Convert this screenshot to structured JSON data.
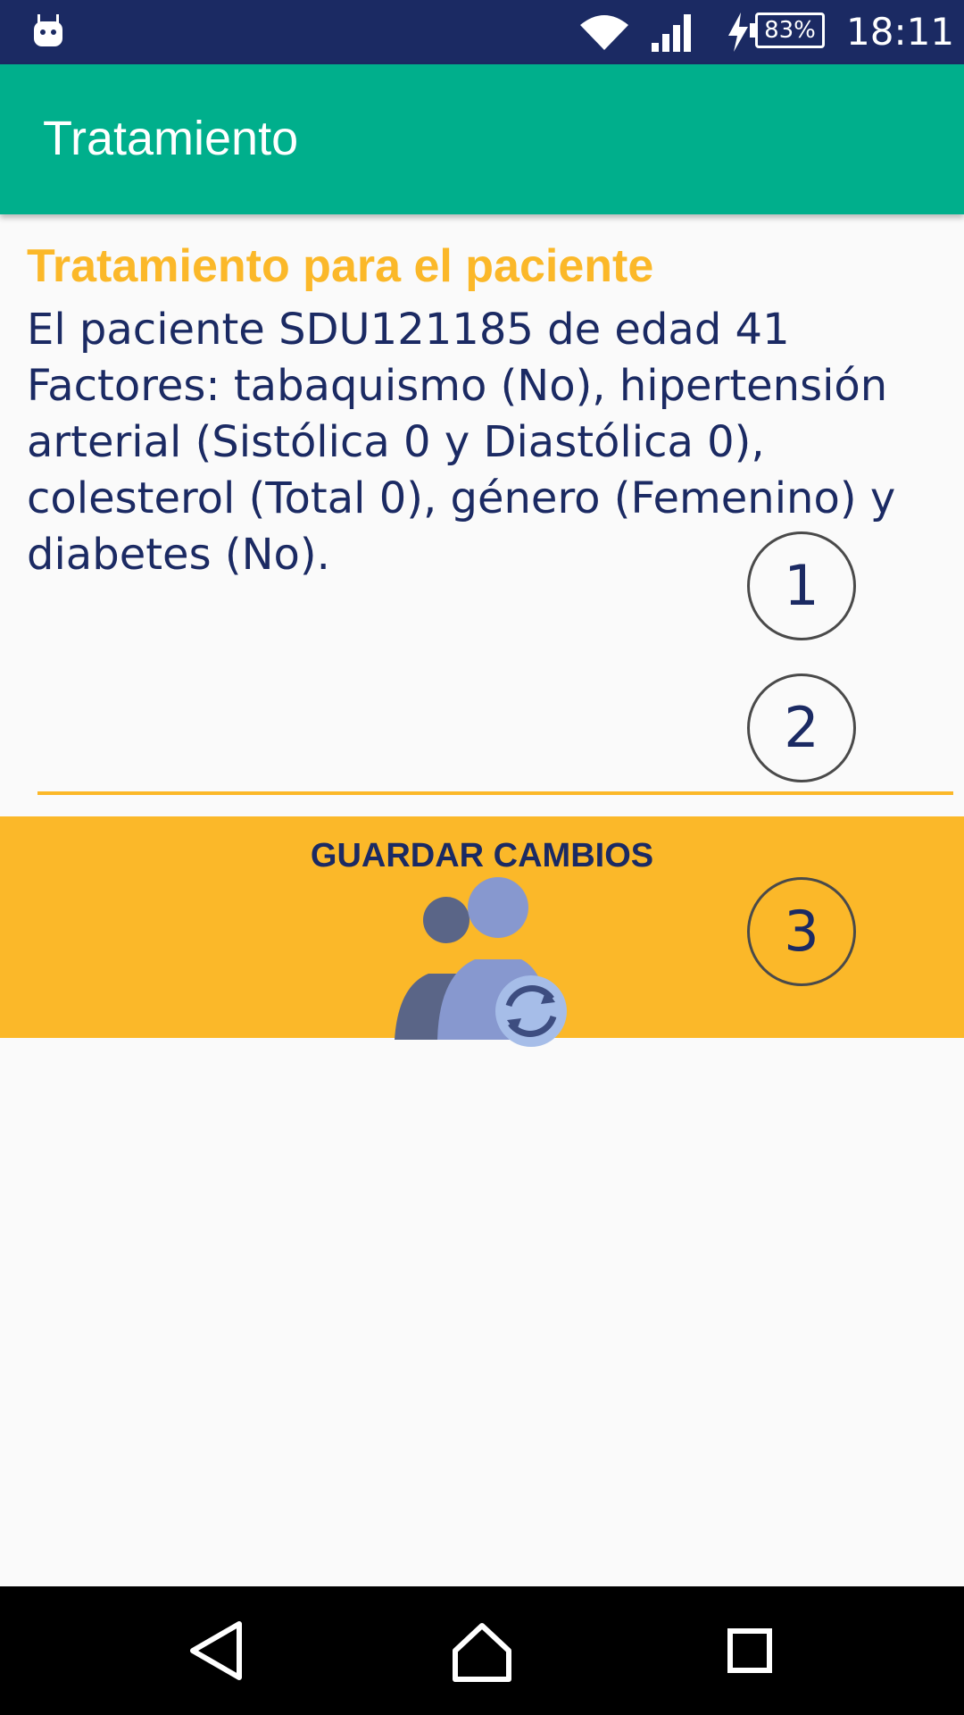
{
  "status_bar": {
    "battery_percent": "83%",
    "time": "18:11",
    "icons": [
      "android-icon",
      "wifi-icon",
      "signal-icon",
      "charging-icon",
      "battery-icon"
    ]
  },
  "app_bar": {
    "title": "Tratamiento"
  },
  "content": {
    "heading": "Tratamiento para el paciente",
    "description_lines": [
      "El paciente SDU121185 de edad 41",
      "Factores: tabaquismo (No), hipertensión",
      "arterial (Sistólica 0 y Diastólica 0),",
      "colesterol (Total 0), género (Femenino) y",
      "diabetes (No)."
    ]
  },
  "markers": [
    "1",
    "2",
    "3"
  ],
  "save_button": {
    "label": "GUARDAR CAMBIOS",
    "icon": "users-sync-icon"
  },
  "nav_bar": {
    "icons": [
      "back-icon",
      "home-icon",
      "recents-icon"
    ]
  },
  "colors": {
    "status_bar": "#1b2a63",
    "app_bar": "#00af8c",
    "accent": "#fbb829",
    "text_primary": "#1b2a63",
    "background": "#fafafa"
  }
}
